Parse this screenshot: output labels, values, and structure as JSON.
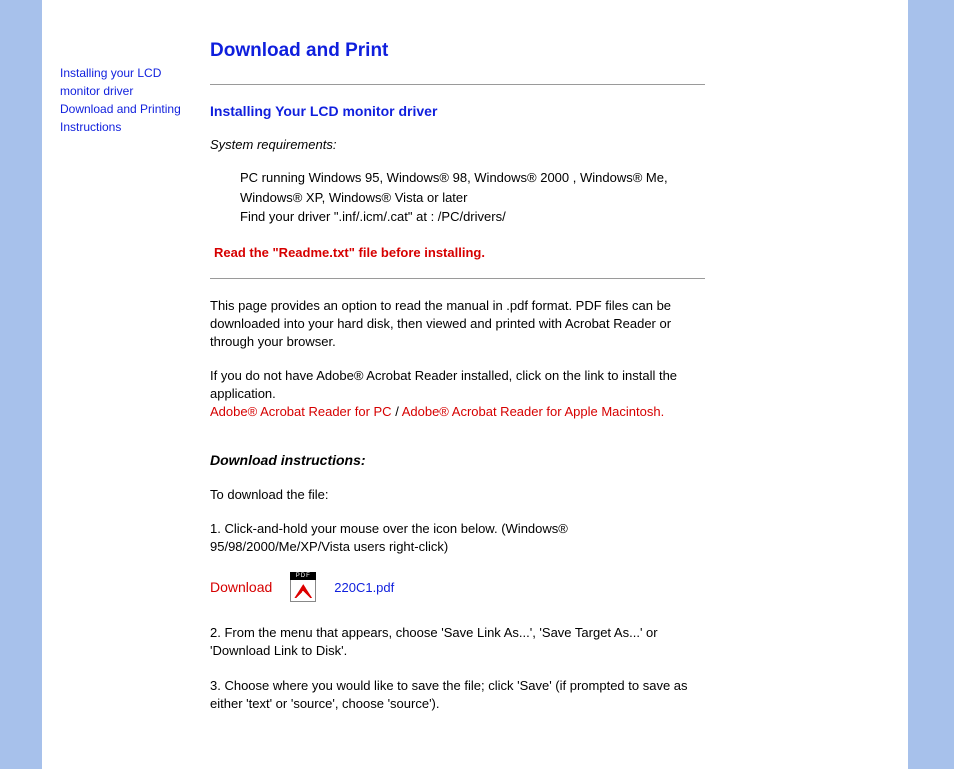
{
  "sidebar": {
    "link1": "Installing your LCD monitor driver",
    "link2": "Download and Printing Instructions"
  },
  "page": {
    "title": "Download and Print",
    "section1_heading": "Installing Your LCD monitor driver",
    "sysreq_label": "System requirements:",
    "req_line1": "PC running Windows 95, Windows® 98, Windows® 2000 , Windows® Me, Windows® XP, Windows® Vista or later",
    "req_line2": "Find your driver \".inf/.icm/.cat\" at : /PC/drivers/",
    "readme_warning": "Read the \"Readme.txt\" file before installing.",
    "intro_para": "This page provides an option to read the manual in .pdf format. PDF files can be downloaded into your hard disk, then viewed and printed with Acrobat Reader or through your browser.",
    "adobe_para_lead": "If you do not have Adobe® Acrobat Reader installed, click on the link to install the application.",
    "adobe_pc_link": "Adobe® Acrobat Reader for PC",
    "adobe_sep": " / ",
    "adobe_mac_link": "Adobe® Acrobat Reader for Apple Macintosh.",
    "dl_heading": "Download instructions:",
    "dl_intro": "To download the file:",
    "step1": "1. Click-and-hold your mouse over the icon below. (Windows® 95/98/2000/Me/XP/Vista users right-click)",
    "download_label": "Download",
    "pdf_filename": "220C1.pdf",
    "step2": "2. From the menu that appears, choose 'Save Link As...', 'Save Target As...' or 'Download Link to Disk'.",
    "step3": "3. Choose where you would like to save the file; click 'Save' (if prompted to save as either 'text' or 'source', choose 'source')."
  }
}
